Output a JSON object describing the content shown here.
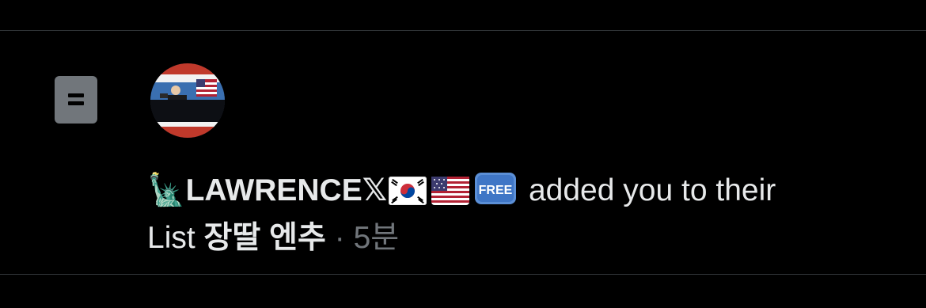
{
  "notification": {
    "user_emoji": "🗽",
    "user_name": "LAWRENCE",
    "user_x_glyph": "𝕏",
    "badges": [
      "south-korea-flag",
      "usa-flag",
      "free-button"
    ],
    "action_text": " added you to their",
    "list_prefix": "List ",
    "list_name": "장딸 엔추",
    "separator": " · ",
    "timestamp": "5분"
  },
  "icons": {
    "list_icon": "list-icon",
    "avatar": "user-avatar"
  },
  "colors": {
    "background": "#000000",
    "divider": "#2f3336",
    "text_primary": "#e7e9ea",
    "text_muted": "#71767b",
    "list_icon_bg": "#71767b"
  }
}
